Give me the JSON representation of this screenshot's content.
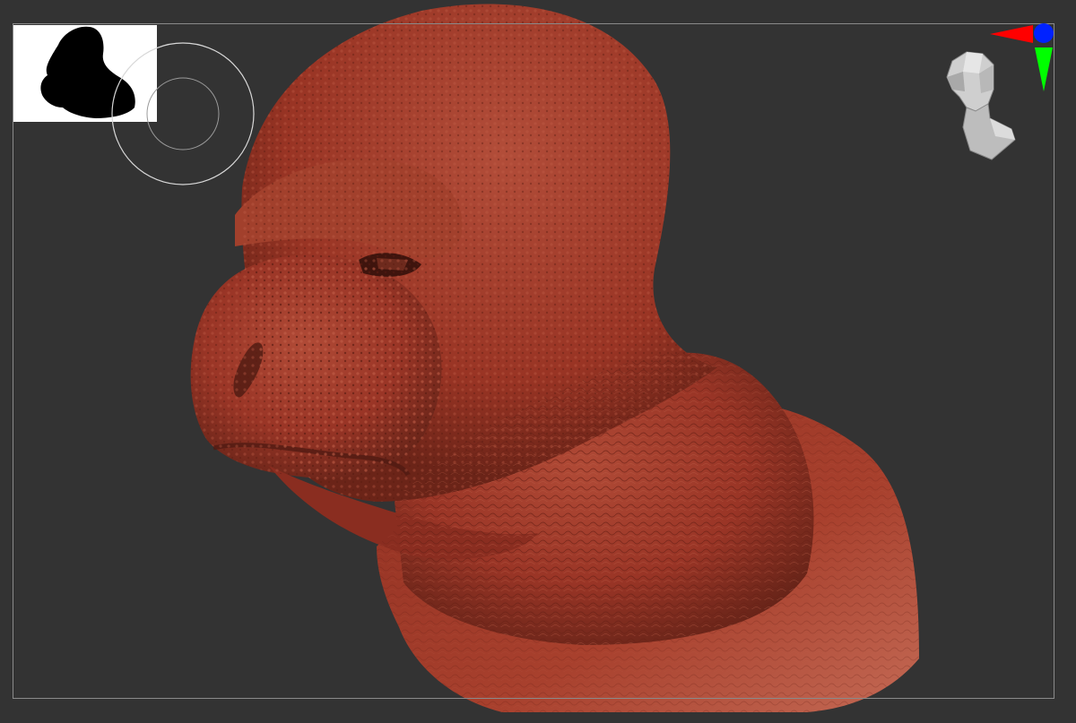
{
  "app": {
    "title": ""
  },
  "viewport": {
    "background": "#333333",
    "frame_color": "#8a8a8a",
    "model": {
      "name": "",
      "material_color": "#9a3526",
      "highlight_color": "#b85a44",
      "shadow_color": "#4e1a12"
    },
    "navigator": {
      "background": "#ffffff",
      "silhouette_color": "#000000"
    },
    "brush_cursor": {
      "color": "#d8d8d8"
    },
    "orientation_gizmo": {
      "icon": "head-orientation-icon",
      "x_axis_color": "#ff0000",
      "y_axis_color": "#00ff00",
      "z_axis_color": "#0000ff"
    }
  }
}
